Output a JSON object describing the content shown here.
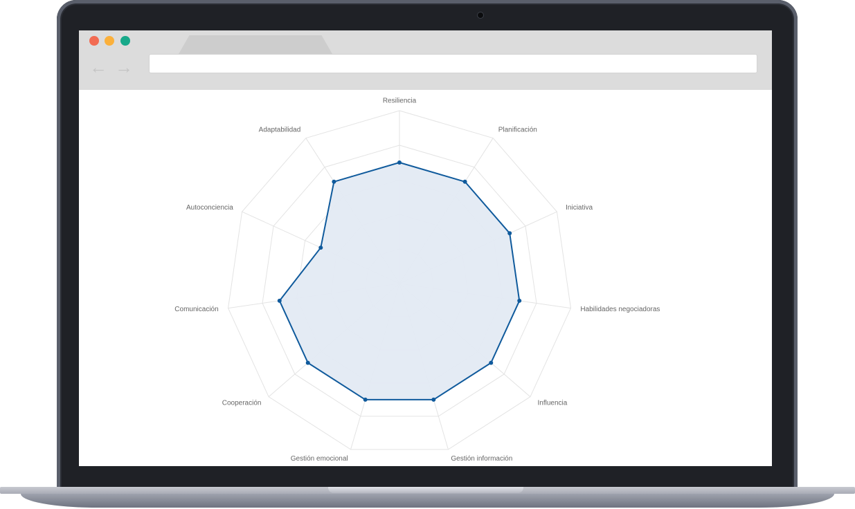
{
  "browser": {
    "address": "",
    "back_icon": "arrow-left-icon",
    "forward_icon": "arrow-right-icon"
  },
  "chart_data": {
    "type": "radar",
    "title": "",
    "categories": [
      "Resiliencia",
      "Planificación",
      "Iniciativa",
      "Habilidades negociadoras",
      "Influencia",
      "Gestión información",
      "Gestión emocional",
      "Cooperación",
      "Comunicación",
      "Autoconciencia",
      "Adaptabilidad"
    ],
    "series": [
      {
        "values": [
          7,
          7,
          7,
          7,
          7,
          7,
          7,
          7,
          7,
          5,
          7
        ],
        "color": "#0f5a9c",
        "fill": "#e3eaf3"
      }
    ],
    "rlim": [
      0,
      10
    ],
    "grid_levels": 5,
    "grid_color": "#e3e3e3",
    "grid": true,
    "legend": "none"
  }
}
